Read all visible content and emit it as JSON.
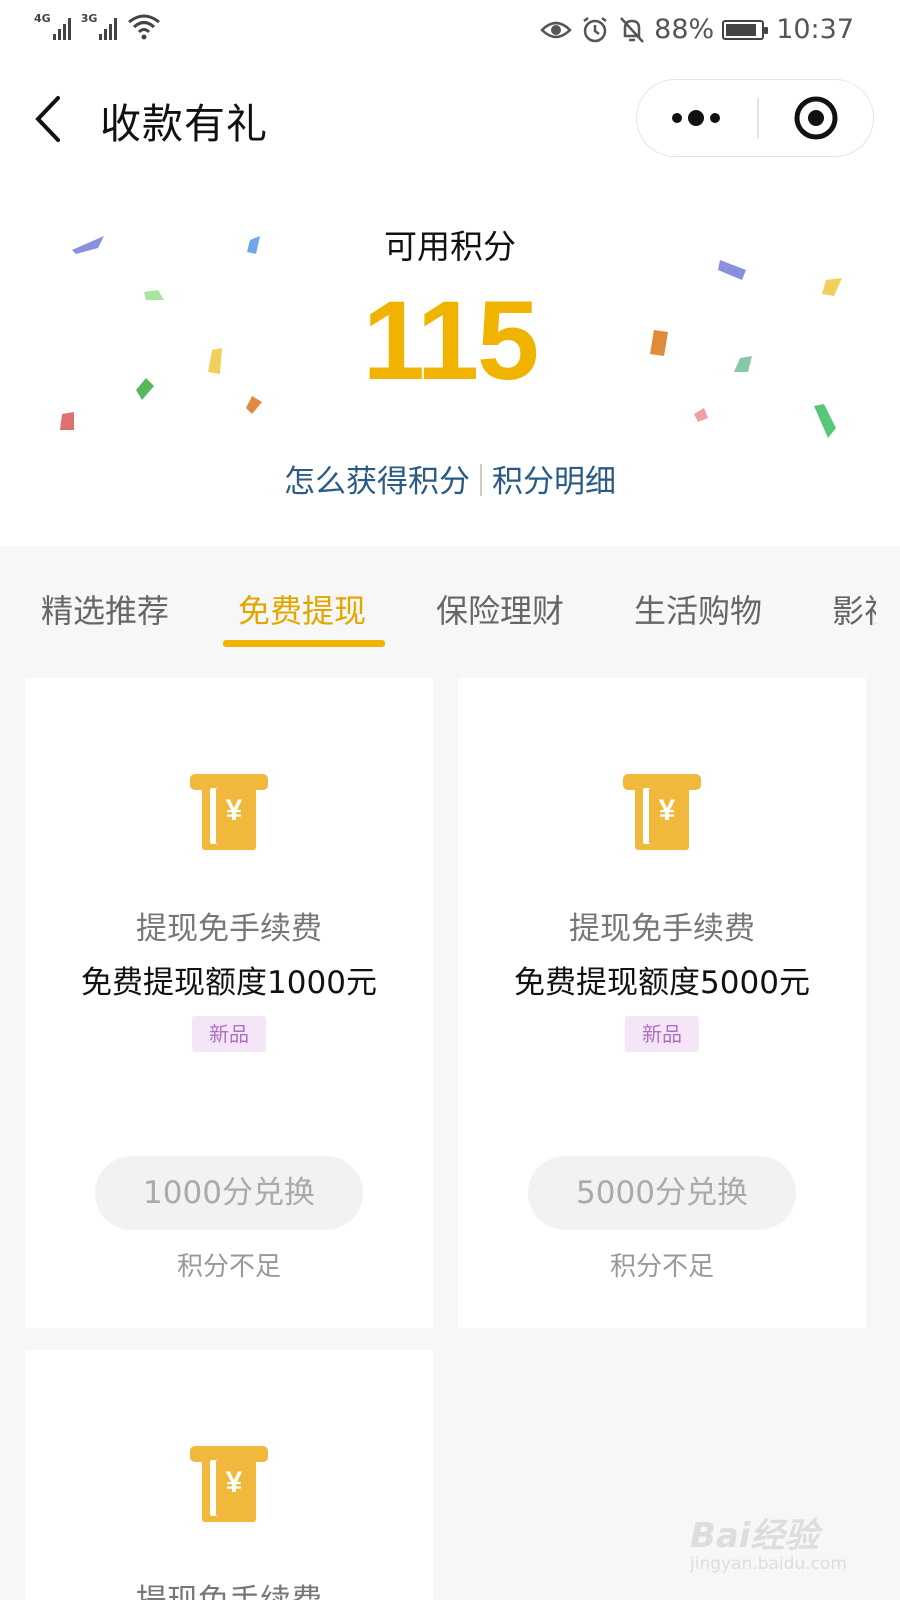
{
  "status_bar": {
    "net1": "4G",
    "net2": "3G",
    "battery_pct": "88%",
    "battery_level": 0.88,
    "time": "10:37"
  },
  "nav": {
    "title": "收款有礼",
    "back_icon": "chevron-left-icon",
    "more_icon": "more-dots-icon",
    "close_icon": "target-close-icon"
  },
  "points": {
    "label": "可用积分",
    "value": "115",
    "link_how": "怎么获得积分",
    "link_detail": "积分明细",
    "value_color": "#f0b400",
    "link_color": "#2a5a86"
  },
  "tabs": [
    {
      "label": "精选推荐"
    },
    {
      "label": "免费提现"
    },
    {
      "label": "保险理财"
    },
    {
      "label": "生活购物"
    },
    {
      "label": "影视"
    }
  ],
  "active_tab": "免费提现",
  "cards": [
    {
      "icon": "withdraw-yuan-icon",
      "name": "提现免手续费",
      "desc": "免费提现额度1000元",
      "badge": "新品",
      "button": "1000分兑换",
      "status": "积分不足"
    },
    {
      "icon": "withdraw-yuan-icon",
      "name": "提现免手续费",
      "desc": "免费提现额度5000元",
      "badge": "新品",
      "button": "5000分兑换",
      "status": "积分不足"
    },
    {
      "icon": "withdraw-yuan-icon",
      "name": "提现免手续费"
    }
  ],
  "watermark": {
    "text": "Bai经验",
    "sub": "jingyan.baidu.com"
  }
}
